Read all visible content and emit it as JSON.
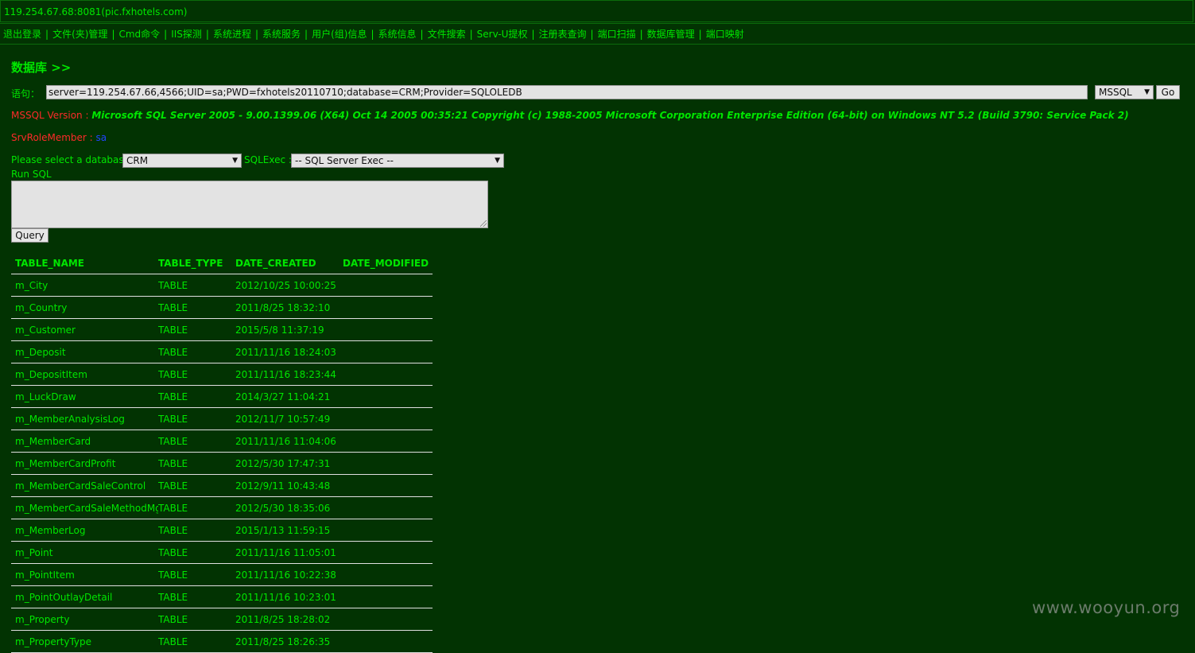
{
  "host": "119.254.67.68:8081(pic.fxhotels.com)",
  "menu": {
    "items": [
      "退出登录",
      "文件(夹)管理",
      "Cmd命令",
      "IIS探测",
      "系统进程",
      "系统服务",
      "用户(组)信息",
      "系统信息",
      "文件搜索",
      "Serv-U提权",
      "注册表查询",
      "端口扫描",
      "数据库管理",
      "端口映射"
    ],
    "separator": "|"
  },
  "section_title": "数据库 >>",
  "statement": {
    "label": "语句：",
    "value": "server=119.254.67.66,4566;UID=sa;PWD=fxhotels20110710;database=CRM;Provider=SQLOLEDB",
    "db_type": "MSSQL",
    "go_label": "Go"
  },
  "version": {
    "label": "MSSQL Version : ",
    "value": "Microsoft SQL Server 2005 - 9.00.1399.06 (X64) Oct 14 2005 00:35:21 Copyright (c) 1988-2005 Microsoft Corporation Enterprise Edition (64-bit) on Windows NT 5.2 (Build 3790: Service Pack 2)"
  },
  "role": {
    "label": "SrvRoleMember : ",
    "value": "sa"
  },
  "database_select": {
    "label": "Please select a database : ",
    "value": "CRM",
    "exec_label": "SQLExec : ",
    "exec_value": "-- SQL Server Exec --"
  },
  "run_sql": {
    "label": "Run SQL",
    "query_label": "Query"
  },
  "table": {
    "headers": [
      "TABLE_NAME",
      "TABLE_TYPE",
      "DATE_CREATED",
      "DATE_MODIFIED"
    ],
    "rows": [
      [
        "m_City",
        "TABLE",
        "2012/10/25 10:00:25",
        ""
      ],
      [
        "m_Country",
        "TABLE",
        "2011/8/25 18:32:10",
        ""
      ],
      [
        "m_Customer",
        "TABLE",
        "2015/5/8 11:37:19",
        ""
      ],
      [
        "m_Deposit",
        "TABLE",
        "2011/11/16 18:24:03",
        ""
      ],
      [
        "m_DepositItem",
        "TABLE",
        "2011/11/16 18:23:44",
        ""
      ],
      [
        "m_LuckDraw",
        "TABLE",
        "2014/3/27 11:04:21",
        ""
      ],
      [
        "m_MemberAnalysisLog",
        "TABLE",
        "2012/11/7 10:57:49",
        ""
      ],
      [
        "m_MemberCard",
        "TABLE",
        "2011/11/16 11:04:06",
        ""
      ],
      [
        "m_MemberCardProfit",
        "TABLE",
        "2012/5/30 17:47:31",
        ""
      ],
      [
        "m_MemberCardSaleControl",
        "TABLE",
        "2012/9/11 10:43:48",
        ""
      ],
      [
        "m_MemberCardSaleMethodMgt",
        "TABLE",
        "2012/5/30 18:35:06",
        ""
      ],
      [
        "m_MemberLog",
        "TABLE",
        "2015/1/13 11:59:15",
        ""
      ],
      [
        "m_Point",
        "TABLE",
        "2011/11/16 11:05:01",
        ""
      ],
      [
        "m_PointItem",
        "TABLE",
        "2011/11/16 10:22:38",
        ""
      ],
      [
        "m_PointOutlayDetail",
        "TABLE",
        "2011/11/16 10:23:01",
        ""
      ],
      [
        "m_Property",
        "TABLE",
        "2011/8/25 18:28:02",
        ""
      ],
      [
        "m_PropertyType",
        "TABLE",
        "2011/8/25 18:26:35",
        ""
      ]
    ]
  },
  "watermark": "www.wooyun.org"
}
